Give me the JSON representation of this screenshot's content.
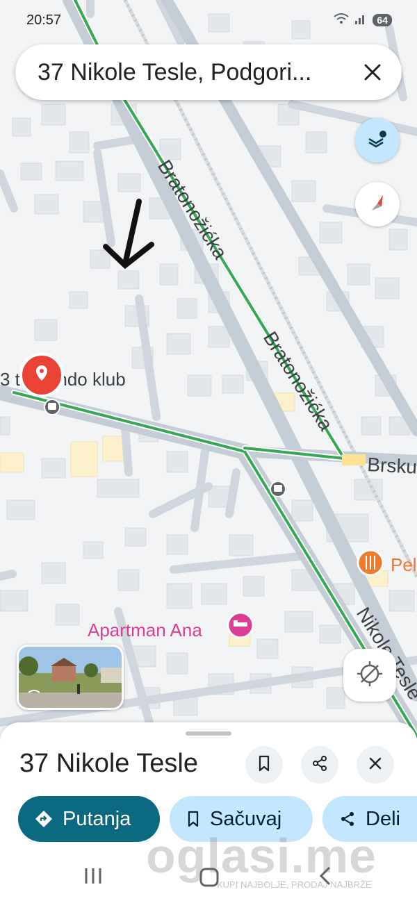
{
  "status_bar": {
    "time": "20:57",
    "battery": "64"
  },
  "search": {
    "query": "37 Nikole Tesle, Podgori..."
  },
  "map": {
    "streets": [
      {
        "label": "Bratonožićka"
      },
      {
        "label": "Bratonožićka"
      },
      {
        "label": "Brsku"
      },
      {
        "label": "Nikole Tesle"
      }
    ],
    "places": {
      "club": "3 t kwondo klub",
      "apartment": "Apartman Ana",
      "restaurant": "Pel"
    },
    "colors": {
      "route_green": "#34a853",
      "pin_red": "#ea4335",
      "hotel_pink": "#d93e93",
      "food_orange": "#ee7a30"
    }
  },
  "sheet": {
    "title": "37 Nikole Tesle",
    "actions": {
      "directions": "Putanja",
      "save": "Sačuvaj",
      "share": "Deli"
    }
  },
  "watermark": {
    "brand": "oglasi.me",
    "tagline": "KUPI NAJBOLJE, PRODAJ NAJBRŽE"
  },
  "icons": [
    "wifi-icon",
    "signal-icon",
    "close-icon",
    "layers-icon",
    "compass-icon",
    "arrow-annotation",
    "location-pin-icon",
    "bus-stop-icon",
    "restaurant-icon",
    "hotel-icon",
    "location-disabled-icon",
    "streetview-thumbnail",
    "bookmark-icon",
    "share-icon",
    "directions-icon",
    "recents-icon",
    "home-icon",
    "back-icon"
  ]
}
